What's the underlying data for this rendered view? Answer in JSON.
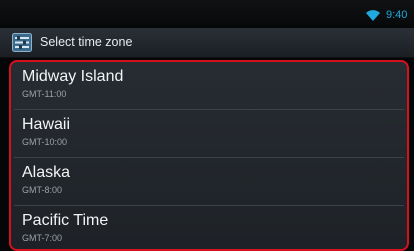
{
  "status_bar": {
    "time": "9:40",
    "icons": [
      "wifi-icon"
    ]
  },
  "header": {
    "icon": "settings-app-icon",
    "title": "Select time zone"
  },
  "time_zones": [
    {
      "name": "Midway Island",
      "offset": "GMT-11:00"
    },
    {
      "name": "Hawaii",
      "offset": "GMT-10:00"
    },
    {
      "name": "Alaska",
      "offset": "GMT-8:00"
    },
    {
      "name": "Pacific Time",
      "offset": "GMT-7:00"
    }
  ],
  "colors": {
    "highlight_border": "#d6101d",
    "clock": "#1fa9dd"
  }
}
